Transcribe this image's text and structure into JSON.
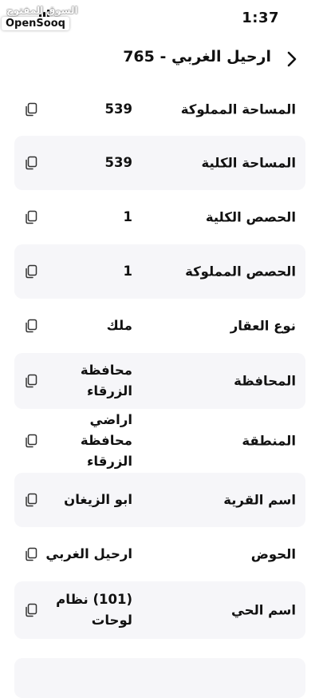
{
  "status_bar": {
    "time": "1:37",
    "watermark_arabic": "السوق المفتوح",
    "watermark_brand": "OpenSooq"
  },
  "header": {
    "title": "ارحيل الغربي - 765"
  },
  "rows": [
    {
      "label": "المساحة المملوكة",
      "value": "539"
    },
    {
      "label": "المساحة الكلية",
      "value": "539"
    },
    {
      "label": "الحصص الكلية",
      "value": "1"
    },
    {
      "label": "الحصص المملوكة",
      "value": "1"
    },
    {
      "label": "نوع العقار",
      "value": "ملك"
    },
    {
      "label": "المحافظة",
      "value": "محافظة الزرقاء"
    },
    {
      "label": "المنطقة",
      "value": "اراضي محافظة\nالزرقاء"
    },
    {
      "label": "اسم القرية",
      "value": "ابو الزيغان"
    },
    {
      "label": "الحوض",
      "value": "ارحيل الغربي"
    },
    {
      "label": "اسم الحي",
      "value": "(101) نظام\nلوحات"
    }
  ],
  "icons": {
    "back": "chevron-right-icon",
    "copy": "copy-icon"
  }
}
